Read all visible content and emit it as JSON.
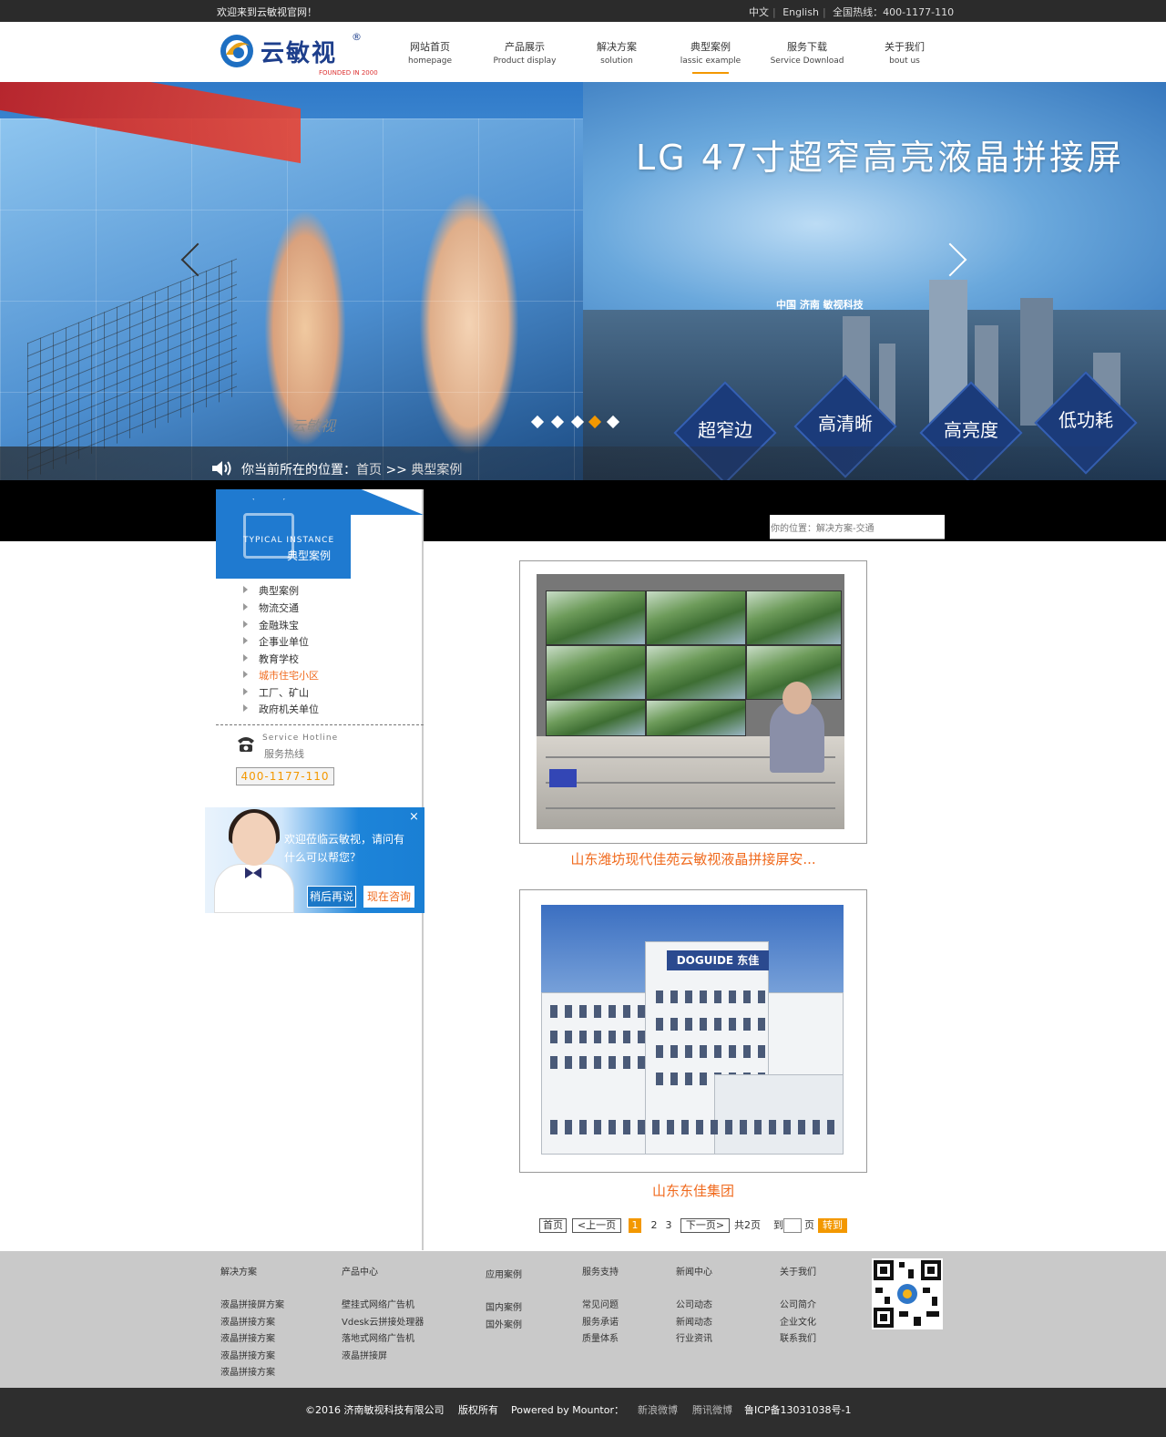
{
  "topbar": {
    "welcome": "欢迎来到云敏视官网！",
    "lang_cn": "中文",
    "lang_en": "English",
    "hotline_label": "全国热线：",
    "hotline_number": "400-1177-110"
  },
  "logo": {
    "name": "云敏视",
    "tagline": "FOUNDED IN 2000",
    "reg": "®"
  },
  "nav": [
    {
      "cn": "网站首页",
      "en": "homepage"
    },
    {
      "cn": "产品展示",
      "en": "Product display"
    },
    {
      "cn": "解决方案",
      "en": "solution"
    },
    {
      "cn": "典型案例",
      "en": "lassic example",
      "active": true
    },
    {
      "cn": "服务下载",
      "en": "Service Download"
    },
    {
      "cn": "关于我们",
      "en": "bout us"
    }
  ],
  "banner": {
    "title": "LG  47寸超窄高亮液晶拼接屏",
    "caption": "中国 济南 敏视科技",
    "stamp": "云敏视",
    "features": [
      "超窄边",
      "高清晰",
      "高亮度",
      "低功耗"
    ],
    "slide_count": 5,
    "active_slide": 4,
    "breadcrumb_prefix": "你当前所在的位置：",
    "breadcrumb_home": "首页",
    "breadcrumb_sep": ">>",
    "breadcrumb_current": "典型案例"
  },
  "sidebar": {
    "title_en": "TYPICAL INSTANCE",
    "title_cn": "典型案例",
    "categories": [
      {
        "label": "典型案例"
      },
      {
        "label": "物流交通"
      },
      {
        "label": " 金融珠宝"
      },
      {
        "label": " 企事业单位"
      },
      {
        "label": " 教育学校"
      },
      {
        "label": " 城市住宅小区",
        "active": true
      },
      {
        "label": " 工厂、矿山"
      },
      {
        "label": " 政府机关单位"
      }
    ],
    "hotline_en": "Service Hotline",
    "hotline_cn": "服务热线",
    "hotline_number": "400-1177-110"
  },
  "chat": {
    "message": "欢迎莅临云敏视，请问有什么可以帮您？",
    "later": "稍后再说",
    "now": "现在咨询",
    "close": "×"
  },
  "content": {
    "location": "你的位置：解决方案-交通",
    "cases": [
      {
        "title": "山东潍坊现代佳苑云敏视液晶拼接屏安..."
      },
      {
        "title": "山东东佳集团",
        "sign": "DOGUIDE 东佳"
      }
    ]
  },
  "pagination": {
    "first": "首页",
    "prev": "<上一页",
    "pages": [
      "1",
      "2",
      "3"
    ],
    "current": "1",
    "next": "下一页>",
    "total": "共2页",
    "goto_prefix": "到",
    "goto_suffix": "页",
    "go": "转到"
  },
  "footer": {
    "columns": [
      {
        "title": "解决方案",
        "items": [
          "液晶拼接屏方案",
          "液晶拼接方案",
          "液晶拼接方案",
          "液晶拼接方案",
          "液晶拼接方案"
        ]
      },
      {
        "title": "产品中心",
        "items": [
          "壁挂式网络广告机",
          "Vdesk云拼接处理器",
          "落地式网络广告机",
          "液晶拼接屏"
        ]
      },
      {
        "title": "应用案例",
        "items": [
          "国内案例",
          "国外案例"
        ]
      },
      {
        "title": "服务支持",
        "items": [
          "常见问题",
          "服务承诺",
          "质量体系"
        ]
      },
      {
        "title": "新闻中心",
        "items": [
          "公司动态",
          "新闻动态",
          "行业资讯"
        ]
      },
      {
        "title": "关于我们",
        "items": [
          "公司简介",
          "企业文化",
          "联系我们"
        ]
      }
    ]
  },
  "bottombar": {
    "copyright": "©2016 济南敏视科技有限公司",
    "rights": "版权所有",
    "powered": "Powered   by   Mountor：",
    "weibo_sina": "新浪微博",
    "weibo_tencent": "腾讯微博",
    "icp": "鲁ICP备13031038号-1"
  }
}
